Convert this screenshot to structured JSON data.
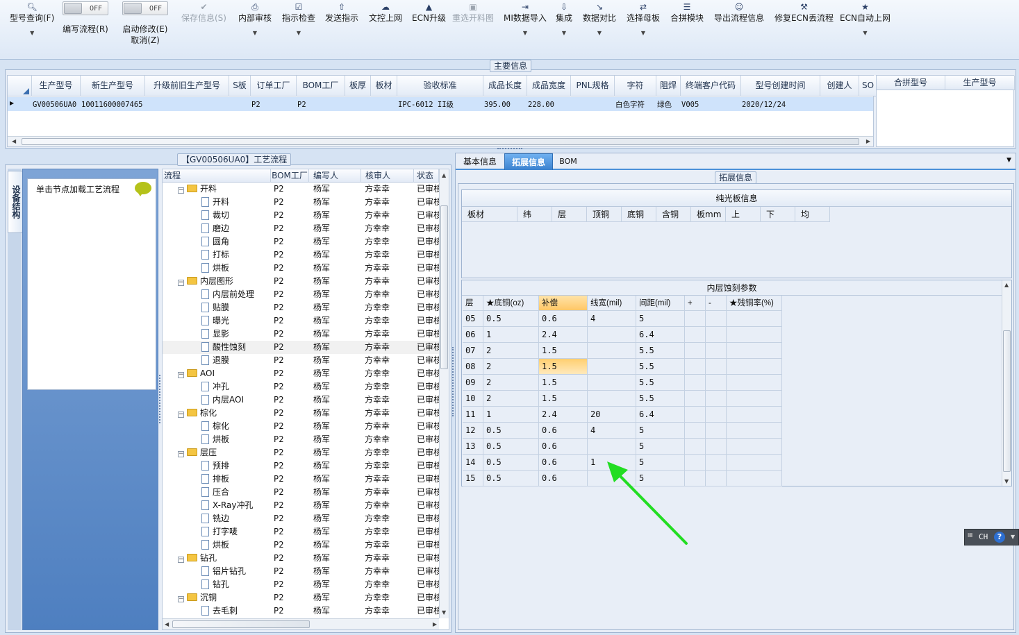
{
  "toolbar": {
    "query": "型号查询(F)",
    "edit_flow": "编写流程(R)",
    "edit_flow_toggle": "OFF",
    "start_edit": "启动修改(E)",
    "start_edit_toggle": "OFF",
    "cancel": "取消(Z)",
    "save": "保存信息(S)",
    "internal_review": "内部审核",
    "instruction_check": "指示检查",
    "send_instruction": "发送指示",
    "doc_upload": "文控上网",
    "ecn_upgrade": "ECN升级",
    "reselect_drawing": "重选开料图",
    "mi_import": "MI数据导入",
    "integrate": "集成",
    "data_compare": "数据对比",
    "select_master": "选择母板",
    "panel_module": "合拼模块",
    "export_flow": "导出流程信息",
    "fix_ecn": "修复ECN丢流程",
    "ecn_auto": "ECN自动上网"
  },
  "main_info": {
    "title": "主要信息",
    "columns": [
      "生产型号",
      "新生产型号",
      "升级前旧生产型号",
      "S板",
      "订单工厂",
      "BOM工厂",
      "板厚",
      "板材",
      "验收标准",
      "成品长度",
      "成品宽度",
      "PNL规格",
      "字符",
      "阻焊",
      "终端客户代码",
      "型号创建时间",
      "创建人",
      "SO"
    ],
    "row": {
      "model": "GV00506UA0",
      "new_model": "10011600007465",
      "order_factory": "P2",
      "bom_factory": "P2",
      "standard": "IPC-6012 II级",
      "length": "395.00",
      "width": "228.00",
      "char": "白色字符",
      "solder": "绿色",
      "customer": "V005",
      "created": "2020/12/24"
    },
    "side_columns": [
      "合拼型号",
      "生产型号"
    ]
  },
  "process": {
    "title": "【GV00506UA0】工艺流程",
    "side_tab": "设备结构",
    "hint": "单击节点加载工艺流程",
    "columns": [
      "流程",
      "BOM工厂",
      "编写人",
      "核审人",
      "状态"
    ],
    "rows": [
      {
        "name": "开料",
        "folder": true,
        "factory": "P2",
        "writer": "杨军",
        "reviewer": "方幸幸",
        "status": "已审核"
      },
      {
        "name": "开料",
        "folder": false,
        "factory": "P2",
        "writer": "杨军",
        "reviewer": "方幸幸",
        "status": "已审核"
      },
      {
        "name": "裁切",
        "folder": false,
        "factory": "P2",
        "writer": "杨军",
        "reviewer": "方幸幸",
        "status": "已审核"
      },
      {
        "name": "磨边",
        "folder": false,
        "factory": "P2",
        "writer": "杨军",
        "reviewer": "方幸幸",
        "status": "已审核"
      },
      {
        "name": "圆角",
        "folder": false,
        "factory": "P2",
        "writer": "杨军",
        "reviewer": "方幸幸",
        "status": "已审核"
      },
      {
        "name": "打标",
        "folder": false,
        "factory": "P2",
        "writer": "杨军",
        "reviewer": "方幸幸",
        "status": "已审核"
      },
      {
        "name": "烘板",
        "folder": false,
        "factory": "P2",
        "writer": "杨军",
        "reviewer": "方幸幸",
        "status": "已审核"
      },
      {
        "name": "内层图形",
        "folder": true,
        "factory": "P2",
        "writer": "杨军",
        "reviewer": "方幸幸",
        "status": "已审核"
      },
      {
        "name": "内层前处理",
        "folder": false,
        "factory": "P2",
        "writer": "杨军",
        "reviewer": "方幸幸",
        "status": "已审核"
      },
      {
        "name": "贴膜",
        "folder": false,
        "factory": "P2",
        "writer": "杨军",
        "reviewer": "方幸幸",
        "status": "已审核"
      },
      {
        "name": "曝光",
        "folder": false,
        "factory": "P2",
        "writer": "杨军",
        "reviewer": "方幸幸",
        "status": "已审核"
      },
      {
        "name": "显影",
        "folder": false,
        "factory": "P2",
        "writer": "杨军",
        "reviewer": "方幸幸",
        "status": "已审核"
      },
      {
        "name": "酸性蚀刻",
        "folder": false,
        "factory": "P2",
        "writer": "杨军",
        "reviewer": "方幸幸",
        "status": "已审核",
        "selected": true
      },
      {
        "name": "退膜",
        "folder": false,
        "factory": "P2",
        "writer": "杨军",
        "reviewer": "方幸幸",
        "status": "已审核"
      },
      {
        "name": "AOI",
        "folder": true,
        "factory": "P2",
        "writer": "杨军",
        "reviewer": "方幸幸",
        "status": "已审核"
      },
      {
        "name": "冲孔",
        "folder": false,
        "factory": "P2",
        "writer": "杨军",
        "reviewer": "方幸幸",
        "status": "已审核"
      },
      {
        "name": "内层AOI",
        "folder": false,
        "factory": "P2",
        "writer": "杨军",
        "reviewer": "方幸幸",
        "status": "已审核"
      },
      {
        "name": "棕化",
        "folder": true,
        "factory": "P2",
        "writer": "杨军",
        "reviewer": "方幸幸",
        "status": "已审核"
      },
      {
        "name": "棕化",
        "folder": false,
        "factory": "P2",
        "writer": "杨军",
        "reviewer": "方幸幸",
        "status": "已审核"
      },
      {
        "name": "烘板",
        "folder": false,
        "factory": "P2",
        "writer": "杨军",
        "reviewer": "方幸幸",
        "status": "已审核"
      },
      {
        "name": "层压",
        "folder": true,
        "factory": "P2",
        "writer": "杨军",
        "reviewer": "方幸幸",
        "status": "已审核"
      },
      {
        "name": "预排",
        "folder": false,
        "factory": "P2",
        "writer": "杨军",
        "reviewer": "方幸幸",
        "status": "已审核"
      },
      {
        "name": "排板",
        "folder": false,
        "factory": "P2",
        "writer": "杨军",
        "reviewer": "方幸幸",
        "status": "已审核"
      },
      {
        "name": "压合",
        "folder": false,
        "factory": "P2",
        "writer": "杨军",
        "reviewer": "方幸幸",
        "status": "已审核"
      },
      {
        "name": "X-Ray冲孔",
        "folder": false,
        "factory": "P2",
        "writer": "杨军",
        "reviewer": "方幸幸",
        "status": "已审核"
      },
      {
        "name": "铣边",
        "folder": false,
        "factory": "P2",
        "writer": "杨军",
        "reviewer": "方幸幸",
        "status": "已审核"
      },
      {
        "name": "打字唛",
        "folder": false,
        "factory": "P2",
        "writer": "杨军",
        "reviewer": "方幸幸",
        "status": "已审核"
      },
      {
        "name": "烘板",
        "folder": false,
        "factory": "P2",
        "writer": "杨军",
        "reviewer": "方幸幸",
        "status": "已审核"
      },
      {
        "name": "钻孔",
        "folder": true,
        "factory": "P2",
        "writer": "杨军",
        "reviewer": "方幸幸",
        "status": "已审核"
      },
      {
        "name": "铝片钻孔",
        "folder": false,
        "factory": "P2",
        "writer": "杨军",
        "reviewer": "方幸幸",
        "status": "已审核"
      },
      {
        "name": "钻孔",
        "folder": false,
        "factory": "P2",
        "writer": "杨军",
        "reviewer": "方幸幸",
        "status": "已审核"
      },
      {
        "name": "沉铜",
        "folder": true,
        "factory": "P2",
        "writer": "杨军",
        "reviewer": "方幸幸",
        "status": "已审核"
      },
      {
        "name": "去毛刺",
        "folder": false,
        "factory": "P2",
        "writer": "杨军",
        "reviewer": "方幸幸",
        "status": "已审核"
      }
    ]
  },
  "tabs": [
    {
      "label": "基本信息",
      "active": false
    },
    {
      "label": "拓展信息",
      "active": true
    },
    {
      "label": "BOM",
      "active": false
    }
  ],
  "ext_info": {
    "title": "拓展信息",
    "plain_board_title": "纯光板信息",
    "plain_board_columns": [
      "板材",
      "纬",
      "层",
      "顶铜",
      "底铜",
      "含铜",
      "板mm",
      "上",
      "下",
      "均"
    ],
    "etch_title": "内层蚀刻参数",
    "etch_columns": [
      "层",
      "★底铜(oz)",
      "补偿",
      "线宽(mil)",
      "间距(mil)",
      "+",
      "-",
      "★残铜率(%)"
    ],
    "etch_rows": [
      {
        "layer": "05",
        "base": "0.5",
        "comp": "0.6",
        "width": "4",
        "spacing": "5"
      },
      {
        "layer": "06",
        "base": "1",
        "comp": "2.4",
        "width": "",
        "spacing": "6.4"
      },
      {
        "layer": "07",
        "base": "2",
        "comp": "1.5",
        "width": "",
        "spacing": "5.5"
      },
      {
        "layer": "08",
        "base": "2",
        "comp": "1.5",
        "width": "",
        "spacing": "5.5",
        "highlight": true
      },
      {
        "layer": "09",
        "base": "2",
        "comp": "1.5",
        "width": "",
        "spacing": "5.5"
      },
      {
        "layer": "10",
        "base": "2",
        "comp": "1.5",
        "width": "",
        "spacing": "5.5"
      },
      {
        "layer": "11",
        "base": "1",
        "comp": "2.4",
        "width": "20",
        "spacing": "6.4"
      },
      {
        "layer": "12",
        "base": "0.5",
        "comp": "0.6",
        "width": "4",
        "spacing": "5"
      },
      {
        "layer": "13",
        "base": "0.5",
        "comp": "0.6",
        "width": "",
        "spacing": "5"
      },
      {
        "layer": "14",
        "base": "0.5",
        "comp": "0.6",
        "width": "1",
        "spacing": "5"
      },
      {
        "layer": "15",
        "base": "0.5",
        "comp": "0.6",
        "width": "",
        "spacing": "5"
      }
    ]
  },
  "ime": {
    "label": "CH"
  },
  "colors": {
    "accent": "#4a90d9",
    "selected_row": "#cfe3fb",
    "highlight_cell": "#ffd27a",
    "annotation_arrow": "#22dd22"
  }
}
